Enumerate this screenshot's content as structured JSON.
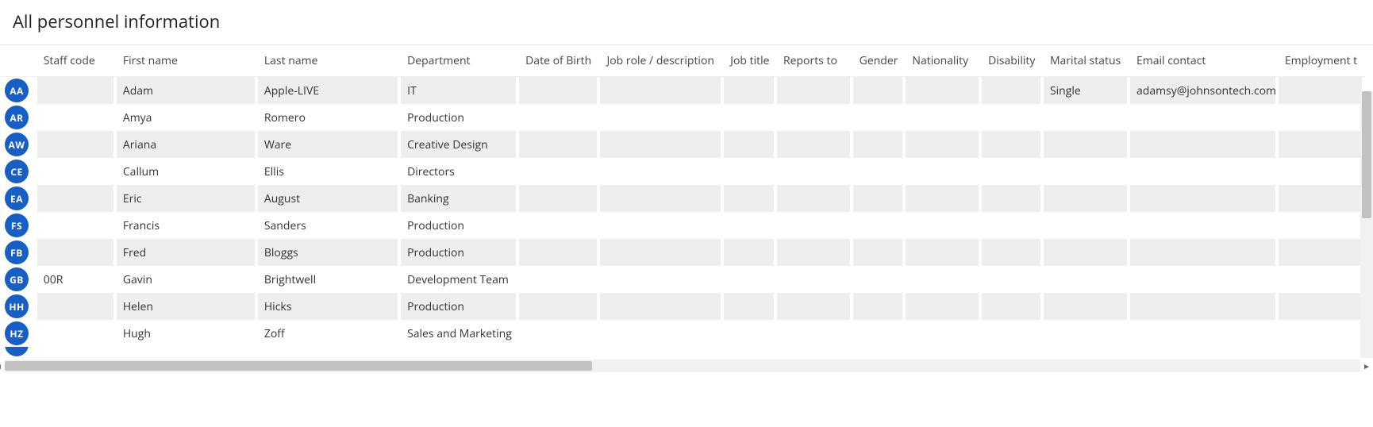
{
  "page": {
    "title": "All personnel information"
  },
  "columns": [
    {
      "key": "staff_code",
      "label": "Staff code"
    },
    {
      "key": "first_name",
      "label": "First name"
    },
    {
      "key": "last_name",
      "label": "Last name"
    },
    {
      "key": "department",
      "label": "Department"
    },
    {
      "key": "dob",
      "label": "Date of Birth"
    },
    {
      "key": "job_role",
      "label": "Job role / description"
    },
    {
      "key": "job_title",
      "label": "Job title"
    },
    {
      "key": "reports_to",
      "label": "Reports to"
    },
    {
      "key": "gender",
      "label": "Gender"
    },
    {
      "key": "nationality",
      "label": "Nationality"
    },
    {
      "key": "disability",
      "label": "Disability"
    },
    {
      "key": "marital_status",
      "label": "Marital status"
    },
    {
      "key": "email",
      "label": "Email contact"
    },
    {
      "key": "employment",
      "label": "Employment t"
    }
  ],
  "rows": [
    {
      "initials": "AA",
      "staff_code": "",
      "first_name": "Adam",
      "last_name": "Apple-LIVE",
      "department": "IT",
      "dob": "",
      "job_role": "",
      "job_title": "",
      "reports_to": "",
      "gender": "",
      "nationality": "",
      "disability": "",
      "marital_status": "Single",
      "email": "adamsy@johnsontech.com",
      "employment": ""
    },
    {
      "initials": "AR",
      "staff_code": "",
      "first_name": "Amya",
      "last_name": "Romero",
      "department": "Production",
      "dob": "",
      "job_role": "",
      "job_title": "",
      "reports_to": "",
      "gender": "",
      "nationality": "",
      "disability": "",
      "marital_status": "",
      "email": "",
      "employment": ""
    },
    {
      "initials": "AW",
      "staff_code": "",
      "first_name": "Ariana",
      "last_name": "Ware",
      "department": "Creative Design",
      "dob": "",
      "job_role": "",
      "job_title": "",
      "reports_to": "",
      "gender": "",
      "nationality": "",
      "disability": "",
      "marital_status": "",
      "email": "",
      "employment": ""
    },
    {
      "initials": "CE",
      "staff_code": "",
      "first_name": "Callum",
      "last_name": "Ellis",
      "department": "Directors",
      "dob": "",
      "job_role": "",
      "job_title": "",
      "reports_to": "",
      "gender": "",
      "nationality": "",
      "disability": "",
      "marital_status": "",
      "email": "",
      "employment": ""
    },
    {
      "initials": "EA",
      "staff_code": "",
      "first_name": "Eric",
      "last_name": "August",
      "department": "Banking",
      "dob": "",
      "job_role": "",
      "job_title": "",
      "reports_to": "",
      "gender": "",
      "nationality": "",
      "disability": "",
      "marital_status": "",
      "email": "",
      "employment": ""
    },
    {
      "initials": "FS",
      "staff_code": "",
      "first_name": "Francis",
      "last_name": "Sanders",
      "department": "Production",
      "dob": "",
      "job_role": "",
      "job_title": "",
      "reports_to": "",
      "gender": "",
      "nationality": "",
      "disability": "",
      "marital_status": "",
      "email": "",
      "employment": ""
    },
    {
      "initials": "FB",
      "staff_code": "",
      "first_name": "Fred",
      "last_name": "Bloggs",
      "department": "Production",
      "dob": "",
      "job_role": "",
      "job_title": "",
      "reports_to": "",
      "gender": "",
      "nationality": "",
      "disability": "",
      "marital_status": "",
      "email": "",
      "employment": ""
    },
    {
      "initials": "GB",
      "staff_code": "00R",
      "first_name": "Gavin",
      "last_name": "Brightwell",
      "department": "Development Team",
      "dob": "",
      "job_role": "",
      "job_title": "",
      "reports_to": "",
      "gender": "",
      "nationality": "",
      "disability": "",
      "marital_status": "",
      "email": "",
      "employment": ""
    },
    {
      "initials": "HH",
      "staff_code": "",
      "first_name": "Helen",
      "last_name": "Hicks",
      "department": "Production",
      "dob": "",
      "job_role": "",
      "job_title": "",
      "reports_to": "",
      "gender": "",
      "nationality": "",
      "disability": "",
      "marital_status": "",
      "email": "",
      "employment": ""
    },
    {
      "initials": "HZ",
      "staff_code": "",
      "first_name": "Hugh",
      "last_name": "Zoff",
      "department": "Sales and Marketing",
      "dob": "",
      "job_role": "",
      "job_title": "",
      "reports_to": "",
      "gender": "",
      "nationality": "",
      "disability": "",
      "marital_status": "",
      "email": "",
      "employment": ""
    }
  ],
  "partial_next_row": {
    "initials": ""
  }
}
